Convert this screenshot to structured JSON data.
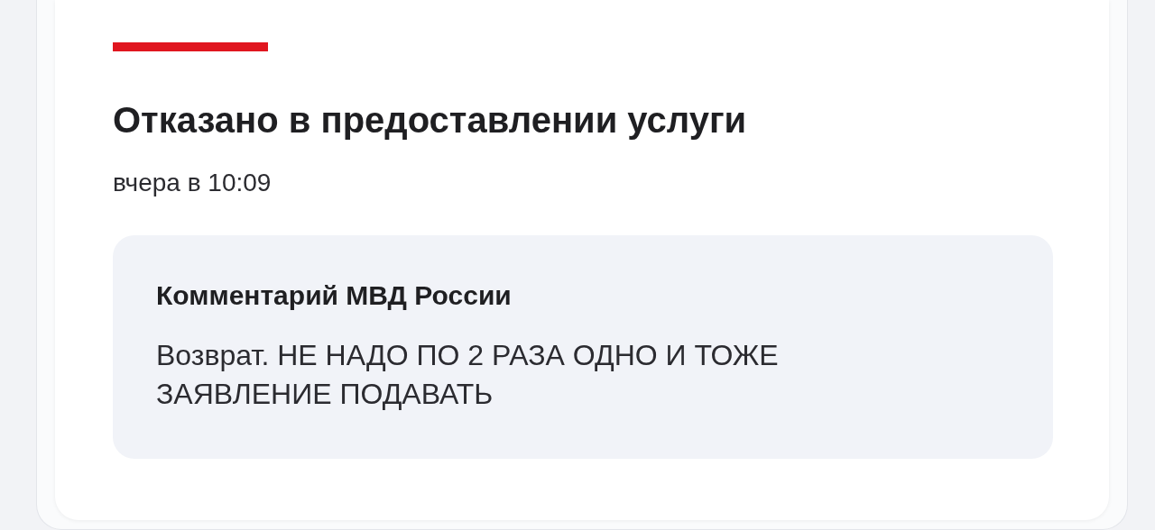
{
  "status": {
    "title": "Отказано в предоставлении услуги",
    "time": "вчера в 10:09",
    "color": "#e0161f"
  },
  "comment": {
    "heading": "Комментарий МВД России",
    "text": "Возврат. НЕ НАДО ПО 2 РАЗА ОДНО И ТОЖЕ ЗАЯВЛЕНИЕ ПОДАВАТЬ"
  }
}
